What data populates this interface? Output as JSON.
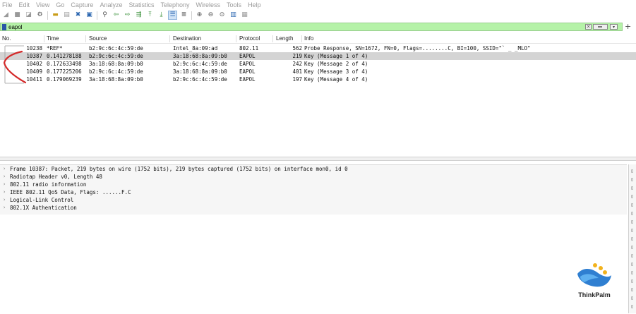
{
  "menu": [
    "File",
    "Edit",
    "View",
    "Go",
    "Capture",
    "Analyze",
    "Statistics",
    "Telephony",
    "Wireless",
    "Tools",
    "Help"
  ],
  "toolbar_icons": [
    "shark-fin-start-icon",
    "stop-square-icon",
    "restart-icon",
    "options-gear-icon",
    "open-folder-icon",
    "save-file-icon",
    "close-file-icon",
    "reload-icon",
    "find-packet-icon",
    "go-back-icon",
    "go-forward-icon",
    "go-to-packet-icon",
    "go-first-icon",
    "go-last-icon",
    "autoscroll-icon",
    "colorize-icon",
    "zoom-in-icon",
    "zoom-out-icon",
    "zoom-normal-icon",
    "resize-columns-icon"
  ],
  "filter": {
    "value": "eapol",
    "add_button": "+"
  },
  "columns": {
    "no": "No.",
    "time": "Time",
    "source": "Source",
    "destination": "Destination",
    "protocol": "Protocol",
    "length": "Length",
    "info": "Info"
  },
  "packets": [
    {
      "no": "10238",
      "time": "*REF*",
      "source": "b2:9c:6c:4c:59:de",
      "destination": "Intel_8a:09:ad",
      "protocol": "802.11",
      "length": "562",
      "info": "Probe Response, SN=1672, FN=0, Flags=........C, BI=100, SSID=\"`   _  _MLO\""
    },
    {
      "no": "10387",
      "time": "0.141278188",
      "source": "b2:9c:6c:4c:59:de",
      "destination": "3a:18:68:8a:09:b0",
      "protocol": "EAPOL",
      "length": "219",
      "info": "Key (Message 1 of 4)"
    },
    {
      "no": "10402",
      "time": "0.172633498",
      "source": "3a:18:68:8a:09:b0",
      "destination": "b2:9c:6c:4c:59:de",
      "protocol": "EAPOL",
      "length": "242",
      "info": "Key (Message 2 of 4)"
    },
    {
      "no": "10409",
      "time": "0.177225206",
      "source": "b2:9c:6c:4c:59:de",
      "destination": "3a:18:68:8a:09:b0",
      "protocol": "EAPOL",
      "length": "401",
      "info": "Key (Message 3 of 4)"
    },
    {
      "no": "10411",
      "time": "0.179069239",
      "source": "3a:18:68:8a:09:b0",
      "destination": "b2:9c:6c:4c:59:de",
      "protocol": "EAPOL",
      "length": "197",
      "info": "Key (Message 4 of 4)"
    }
  ],
  "selected_packet": "10387",
  "details": [
    "Frame 10387: Packet, 219 bytes on wire (1752 bits), 219 bytes captured (1752 bits) on interface mon0, id 0",
    "Radiotap Header v0, Length 48",
    "802.11 radio information",
    "IEEE 802.11 QoS Data, Flags: ......F.C",
    "Logical-Link Control",
    "802.1X Authentication"
  ],
  "colors": {
    "filter_valid": "#b5f2a8",
    "selected_row": "#d4d4d4",
    "annotation": "#d42a2a",
    "logo_blue": "#2f7fd1",
    "logo_gold": "#f2b21c"
  },
  "branding": {
    "logo_text": "ThinkPalm"
  }
}
